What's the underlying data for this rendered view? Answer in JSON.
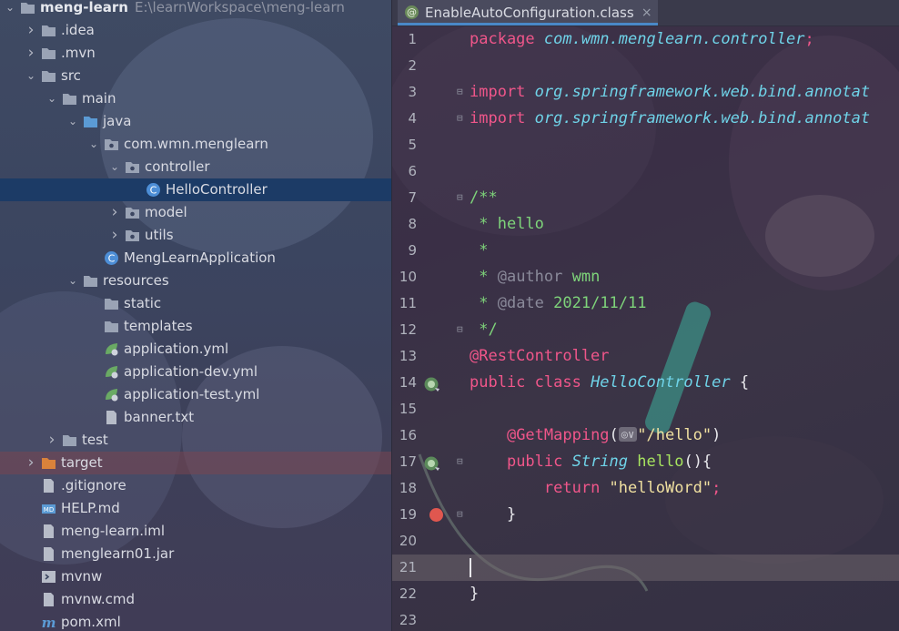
{
  "project": {
    "name": "meng-learn",
    "path": "E:\\learnWorkspace\\meng-learn",
    "tree": [
      {
        "label": "meng-learn",
        "arrow": "down",
        "icon": "folder-icon",
        "bold": true
      },
      {
        "label": ".idea",
        "arrow": "right",
        "icon": "folder-icon"
      },
      {
        "label": ".mvn",
        "arrow": "right",
        "icon": "folder-icon"
      },
      {
        "label": "src",
        "arrow": "down",
        "icon": "folder-icon"
      },
      {
        "label": "main",
        "arrow": "down",
        "icon": "folder-icon"
      },
      {
        "label": "java",
        "arrow": "down",
        "icon": "source-folder-icon"
      },
      {
        "label": "com.wmn.menglearn",
        "arrow": "down",
        "icon": "package-icon"
      },
      {
        "label": "controller",
        "arrow": "down",
        "icon": "package-icon"
      },
      {
        "label": "HelloController",
        "arrow": "",
        "icon": "class-icon",
        "selected": true
      },
      {
        "label": "model",
        "arrow": "right",
        "icon": "package-icon"
      },
      {
        "label": "utils",
        "arrow": "right",
        "icon": "package-icon"
      },
      {
        "label": "MengLearnApplication",
        "arrow": "",
        "icon": "spring-boot-class-icon"
      },
      {
        "label": "resources",
        "arrow": "down",
        "icon": "resources-folder-icon"
      },
      {
        "label": "static",
        "arrow": "",
        "icon": "folder-icon"
      },
      {
        "label": "templates",
        "arrow": "",
        "icon": "folder-icon"
      },
      {
        "label": "application.yml",
        "arrow": "",
        "icon": "spring-yaml-icon"
      },
      {
        "label": "application-dev.yml",
        "arrow": "",
        "icon": "spring-yaml-icon"
      },
      {
        "label": "application-test.yml",
        "arrow": "",
        "icon": "spring-yaml-icon"
      },
      {
        "label": "banner.txt",
        "arrow": "",
        "icon": "text-file-icon"
      },
      {
        "label": "test",
        "arrow": "right",
        "icon": "folder-icon"
      },
      {
        "label": "target",
        "arrow": "right",
        "icon": "excluded-folder-icon",
        "excluded": true
      },
      {
        "label": ".gitignore",
        "arrow": "",
        "icon": "ignore-file-icon"
      },
      {
        "label": "HELP.md",
        "arrow": "",
        "icon": "markdown-icon"
      },
      {
        "label": "meng-learn.iml",
        "arrow": "",
        "icon": "iml-file-icon"
      },
      {
        "label": "menglearn01.jar",
        "arrow": "",
        "icon": "jar-icon"
      },
      {
        "label": "mvnw",
        "arrow": "",
        "icon": "shell-script-icon"
      },
      {
        "label": "mvnw.cmd",
        "arrow": "",
        "icon": "text-file-icon"
      },
      {
        "label": "pom.xml",
        "arrow": "",
        "icon": "maven-icon"
      }
    ]
  },
  "editor": {
    "tab_label": "EnableAutoConfiguration.class",
    "tab_close": "×",
    "current_line": 21,
    "lines": [
      {
        "n": "1",
        "tokens": [
          [
            "kw",
            "package "
          ],
          [
            "pkg",
            "com.wmn.menglearn.controller"
          ],
          [
            "kw",
            ";"
          ]
        ]
      },
      {
        "n": "2",
        "tokens": []
      },
      {
        "n": "3",
        "tokens": [
          [
            "kw",
            "import "
          ],
          [
            "pkg",
            "org.springframework.web.bind.annotat"
          ]
        ],
        "fold": "⊟"
      },
      {
        "n": "4",
        "tokens": [
          [
            "kw",
            "import "
          ],
          [
            "pkg",
            "org.springframework.web.bind.annotat"
          ]
        ],
        "fold": "⊟"
      },
      {
        "n": "5",
        "tokens": []
      },
      {
        "n": "6",
        "tokens": []
      },
      {
        "n": "7",
        "tokens": [
          [
            "cmt",
            "/**"
          ]
        ],
        "fold": "⊟"
      },
      {
        "n": "8",
        "tokens": [
          [
            "cmt",
            " * hello"
          ]
        ]
      },
      {
        "n": "9",
        "tokens": [
          [
            "cmt",
            " *"
          ]
        ]
      },
      {
        "n": "10",
        "tokens": [
          [
            "cmt",
            " * "
          ],
          [
            "tag",
            "@author"
          ],
          [
            "cmt",
            " wmn"
          ]
        ]
      },
      {
        "n": "11",
        "tokens": [
          [
            "cmt",
            " * "
          ],
          [
            "tag",
            "@date"
          ],
          [
            "cmt",
            " 2021/11/11"
          ]
        ]
      },
      {
        "n": "12",
        "tokens": [
          [
            "cmt",
            " */"
          ]
        ],
        "fold": "⊟"
      },
      {
        "n": "13",
        "tokens": [
          [
            "ann",
            "@RestController"
          ]
        ]
      },
      {
        "n": "14",
        "tokens": [
          [
            "kw",
            "public class "
          ],
          [
            "cls",
            "HelloController"
          ],
          [
            "plain",
            " {"
          ]
        ],
        "gutter": "spring-bean-icon"
      },
      {
        "n": "15",
        "tokens": []
      },
      {
        "n": "16",
        "tokens": [
          [
            "plain",
            "    "
          ],
          [
            "ann",
            "@GetMapping"
          ],
          [
            "plain",
            "("
          ],
          [
            "inlay",
            "◎∨"
          ],
          [
            "str",
            "\"/hello\""
          ],
          [
            "plain",
            ")"
          ]
        ]
      },
      {
        "n": "17",
        "tokens": [
          [
            "plain",
            "    "
          ],
          [
            "kw",
            "public "
          ],
          [
            "cls",
            "String "
          ],
          [
            "fn",
            "hello"
          ],
          [
            "plain",
            "(){"
          ]
        ],
        "gutter": "web-endpoint-icon",
        "fold": "⊟"
      },
      {
        "n": "18",
        "tokens": [
          [
            "plain",
            "        "
          ],
          [
            "kw",
            "return "
          ],
          [
            "str",
            "\"helloWord\""
          ],
          [
            "kw",
            ";"
          ]
        ]
      },
      {
        "n": "19",
        "tokens": [
          [
            "plain",
            "    }"
          ]
        ],
        "breakpoint": true,
        "fold": "⊟"
      },
      {
        "n": "20",
        "tokens": []
      },
      {
        "n": "21",
        "tokens": [],
        "caret": true
      },
      {
        "n": "22",
        "tokens": [
          [
            "plain",
            "}"
          ]
        ]
      },
      {
        "n": "23",
        "tokens": []
      }
    ]
  }
}
